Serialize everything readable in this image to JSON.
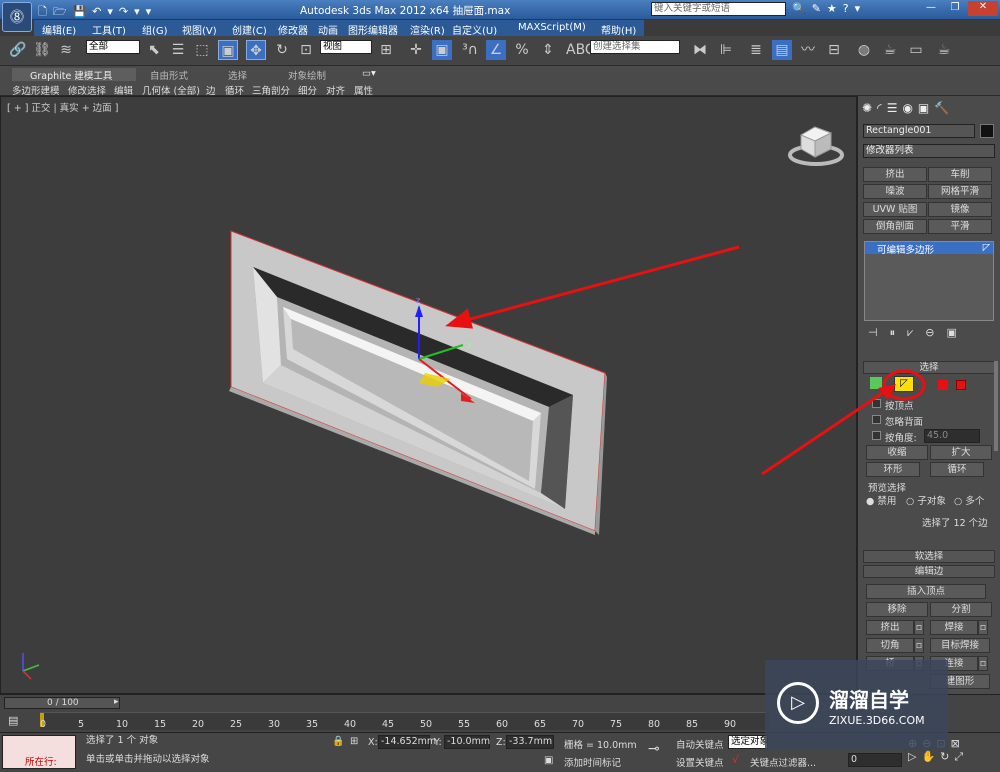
{
  "title": "Autodesk 3ds Max  2012 x64    抽屉面.max",
  "search_placeholder": "键入关键字或短语",
  "menu": [
    "编辑(E)",
    "工具(T)",
    "组(G)",
    "视图(V)",
    "创建(C)",
    "修改器",
    "动画",
    "图形编辑器",
    "渲染(R)",
    "自定义(U)",
    "MAXScript(M)",
    "帮助(H)"
  ],
  "toolbar": {
    "selection_filter": "全部",
    "ref_coord": "视图",
    "named_selection": "创建选择集"
  },
  "ribbon": {
    "tabs": [
      "Graphite 建模工具",
      "自由形式",
      "选择",
      "对象绘制"
    ],
    "items": [
      "多边形建模",
      "修改选择",
      "编辑",
      "几何体 (全部)",
      "边",
      "循环",
      "三角剖分",
      "细分",
      "对齐",
      "属性"
    ]
  },
  "viewport": {
    "label": "[ + ] 正交 | 真实 + 边面 ]"
  },
  "cmd": {
    "object_name": "Rectangle001",
    "modifier_list": "修改器列表",
    "mod_buttons": [
      "挤出",
      "车削",
      "噪波",
      "网格平滑",
      "UVW 贴图",
      "镜像",
      "倒角剖面",
      "平滑"
    ],
    "stack_item": "可编辑多边形",
    "select_title": "选择",
    "by_vertex": "按顶点",
    "ignore_backface": "忽略背面",
    "by_angle": "按角度:",
    "angle_value": "45.0",
    "shrink": "收缩",
    "grow": "扩大",
    "ring": "环形",
    "loop": "循环",
    "preview_select": "预览选择",
    "disable": "禁用",
    "subobject": "子对象",
    "multi": "多个",
    "selected_count": "选择了 12 个边",
    "soft_select": "软选择",
    "edit_edges": "编辑边",
    "insert_vertex": "插入顶点",
    "remove": "移除",
    "split": "分割",
    "extrude": "挤出",
    "weld": "焊接",
    "chamfer": "切角",
    "target_weld": "目标焊接",
    "bridge": "桥",
    "connect": "连接",
    "create_shape": "建图形"
  },
  "timeline": {
    "frame": "0 / 100",
    "ticks": [
      "0",
      "5",
      "10",
      "15",
      "20",
      "25",
      "30",
      "35",
      "40",
      "45",
      "50",
      "55",
      "60",
      "65",
      "70",
      "75",
      "80",
      "85",
      "90"
    ]
  },
  "status": {
    "in_progress": "所在行:",
    "selected": "选择了 1 个 对象",
    "hint": "单击或单击并拖动以选择对象",
    "x_label": "X:",
    "x": "-14.652mm",
    "y_label": "Y:",
    "y": "-10.0mm",
    "z_label": "Z:",
    "z": "-33.7mm",
    "grid": "栅格 = 10.0mm",
    "add_tag": "添加时间标记",
    "auto_key": "自动关键点",
    "selected_obj": "选定对象",
    "set_key": "设置关键点",
    "key_filter": "关键点过滤器...",
    "frame_field": "0"
  },
  "watermark": {
    "brand": "溜溜自学",
    "url": "ZIXUE.3D66.COM"
  },
  "colors": {
    "accent": "#e81010",
    "selection": "#3a6fc4",
    "highlight": "#ffe000"
  }
}
